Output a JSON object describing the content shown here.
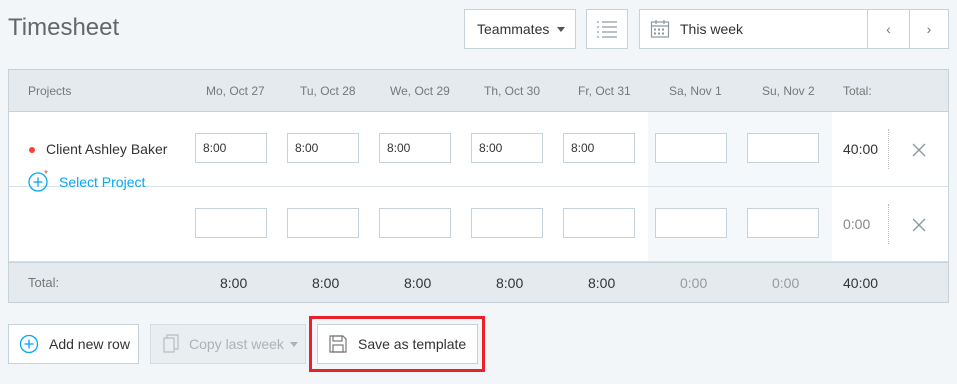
{
  "page": {
    "title": "Timesheet"
  },
  "toolbar": {
    "teammates_label": "Teammates",
    "week_label": "This week",
    "prev_label": "‹",
    "next_label": "›"
  },
  "table": {
    "columns": {
      "projects": "Projects",
      "days": [
        "Mo, Oct 27",
        "Tu, Oct 28",
        "We, Oct 29",
        "Th, Oct 30",
        "Fr, Oct 31",
        "Sa, Nov 1",
        "Su, Nov 2"
      ],
      "total": "Total:"
    },
    "rows": [
      {
        "project": "Client Ashley Baker",
        "project_color": "#f44336",
        "values": [
          "8:00",
          "8:00",
          "8:00",
          "8:00",
          "8:00",
          "",
          ""
        ],
        "total": "40:00"
      },
      {
        "project": "Select Project",
        "project_color": "#03a9f4",
        "values": [
          "",
          "",
          "",
          "",
          "",
          "",
          ""
        ],
        "total": "0:00"
      }
    ],
    "footer": {
      "label": "Total:",
      "values": [
        "8:00",
        "8:00",
        "8:00",
        "8:00",
        "8:00",
        "0:00",
        "0:00"
      ],
      "total": "40:00"
    }
  },
  "actions": {
    "add_row": "Add new row",
    "copy_last_week": "Copy last week",
    "save_template": "Save as template"
  },
  "colors": {
    "accent": "#03a9f4",
    "highlight": "#e8212a",
    "dot": "#f44336"
  },
  "icons": [
    "list-icon",
    "calendar-icon",
    "plus-circle-icon",
    "copy-icon",
    "save-icon",
    "close-icon"
  ]
}
